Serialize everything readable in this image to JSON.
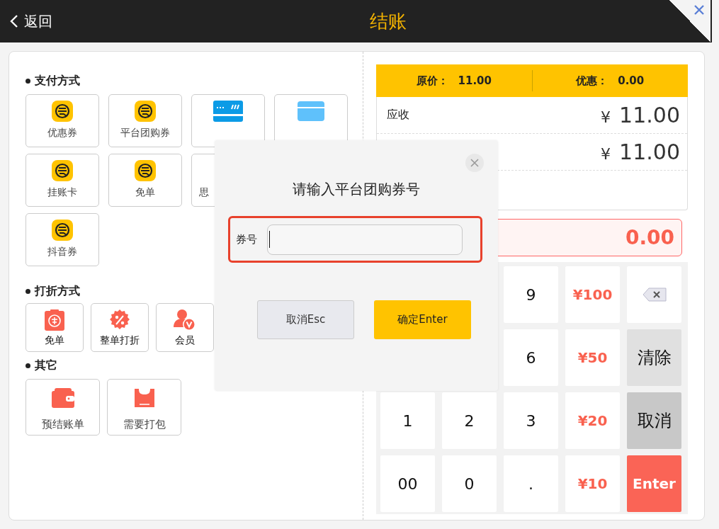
{
  "header": {
    "back": "返回",
    "title": "结账"
  },
  "payment": {
    "heading": "支付方式",
    "rows": [
      [
        {
          "kind": "coupon",
          "label": "优惠券"
        },
        {
          "kind": "coupon",
          "label": "平台团购券"
        },
        {
          "kind": "bankcard"
        },
        {
          "kind": "storecard"
        }
      ],
      [
        {
          "kind": "coupon",
          "label": "挂账卡"
        },
        {
          "kind": "coupon",
          "label": "免单"
        },
        {
          "kind": "blank",
          "label": "思"
        }
      ],
      [
        {
          "kind": "coupon",
          "label": "抖音券"
        }
      ]
    ]
  },
  "discount": {
    "heading": "打折方式",
    "rows": [
      [
        {
          "kind": "freebill",
          "label": "免单"
        },
        {
          "kind": "percent",
          "label": "整单打折"
        },
        {
          "kind": "member",
          "label": "会员"
        }
      ]
    ]
  },
  "other": {
    "heading": "其它",
    "rows": [
      [
        {
          "kind": "wallet",
          "label": "预结账单"
        },
        {
          "kind": "bag",
          "label": "需要打包"
        }
      ]
    ]
  },
  "summary": {
    "original_label": "原价：",
    "original": "11.00",
    "discount_label": "优惠：",
    "discount": "0.00",
    "rows": [
      {
        "label": "应收",
        "currency": "¥",
        "amount": "11.00"
      },
      {
        "currency": "¥",
        "amount": "11.00"
      },
      {}
    ]
  },
  "pay_amount": "0.00",
  "keypad": [
    [
      {
        "kind": "digit",
        "label": "9"
      },
      {
        "kind": "cash",
        "label": "¥100"
      },
      {
        "kind": "backspace"
      }
    ],
    [
      {
        "kind": "digit",
        "label": "6"
      },
      {
        "kind": "cash",
        "label": "¥50"
      },
      {
        "kind": "clear",
        "label": "清除"
      }
    ],
    [
      {
        "kind": "digit",
        "label": "1"
      },
      {
        "kind": "digit",
        "label": "2"
      },
      {
        "kind": "digit",
        "label": "3"
      },
      {
        "kind": "cash",
        "label": "¥20"
      },
      {
        "kind": "cancel",
        "label": "取消"
      }
    ],
    [
      {
        "kind": "digit",
        "label": "00"
      },
      {
        "kind": "digit",
        "label": "0"
      },
      {
        "kind": "digit",
        "label": "."
      },
      {
        "kind": "cash",
        "label": "¥10"
      },
      {
        "kind": "enter",
        "label": "Enter"
      }
    ]
  ],
  "dialog": {
    "title": "请输入平台团购券号",
    "field_label": "券号",
    "focused": true,
    "highlighted": true,
    "cancel": "取消Esc",
    "confirm": "确定Enter"
  }
}
